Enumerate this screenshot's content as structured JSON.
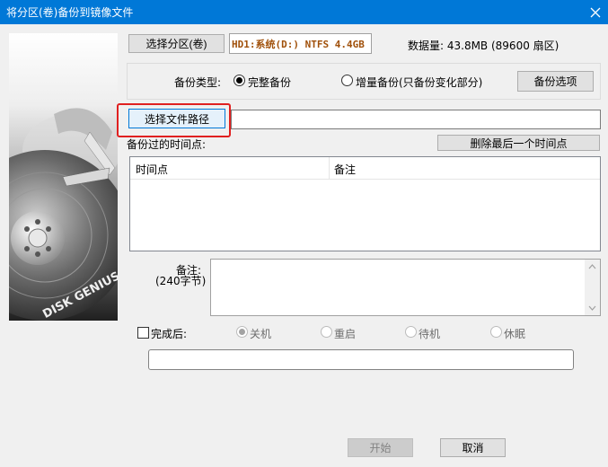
{
  "window": {
    "title": "将分区(卷)备份到镜像文件"
  },
  "partition": {
    "select_button": "选择分区(卷)",
    "selected": "HD1:系统(D:) NTFS 4.4GB",
    "data_size": "数据量: 43.8MB (89600 扇区)"
  },
  "backup_type": {
    "label": "备份类型:",
    "options": [
      "完整备份",
      "增量备份(只备份变化部分)"
    ],
    "selected_index": 0,
    "options_button": "备份选项"
  },
  "file_path": {
    "select_button": "选择文件路径",
    "value": ""
  },
  "time_points": {
    "label": "备份过的时间点:",
    "delete_button": "删除最后一个时间点",
    "columns": [
      "时间点",
      "备注"
    ],
    "rows": []
  },
  "note": {
    "label": "备注:",
    "limit": "(240字节)",
    "value": ""
  },
  "after_completion": {
    "label": "完成后:",
    "checked": false,
    "options": [
      "关机",
      "重启",
      "待机",
      "休眠"
    ],
    "selected_index": 0
  },
  "progress": {
    "value": 0
  },
  "footer": {
    "start_button": "开始",
    "cancel_button": "取消"
  },
  "logo": {
    "text": "DISK GENIUS"
  },
  "colors": {
    "title_bar": "#0078d7",
    "highlight_box": "#e02020",
    "partition_text": "#a0500a"
  }
}
